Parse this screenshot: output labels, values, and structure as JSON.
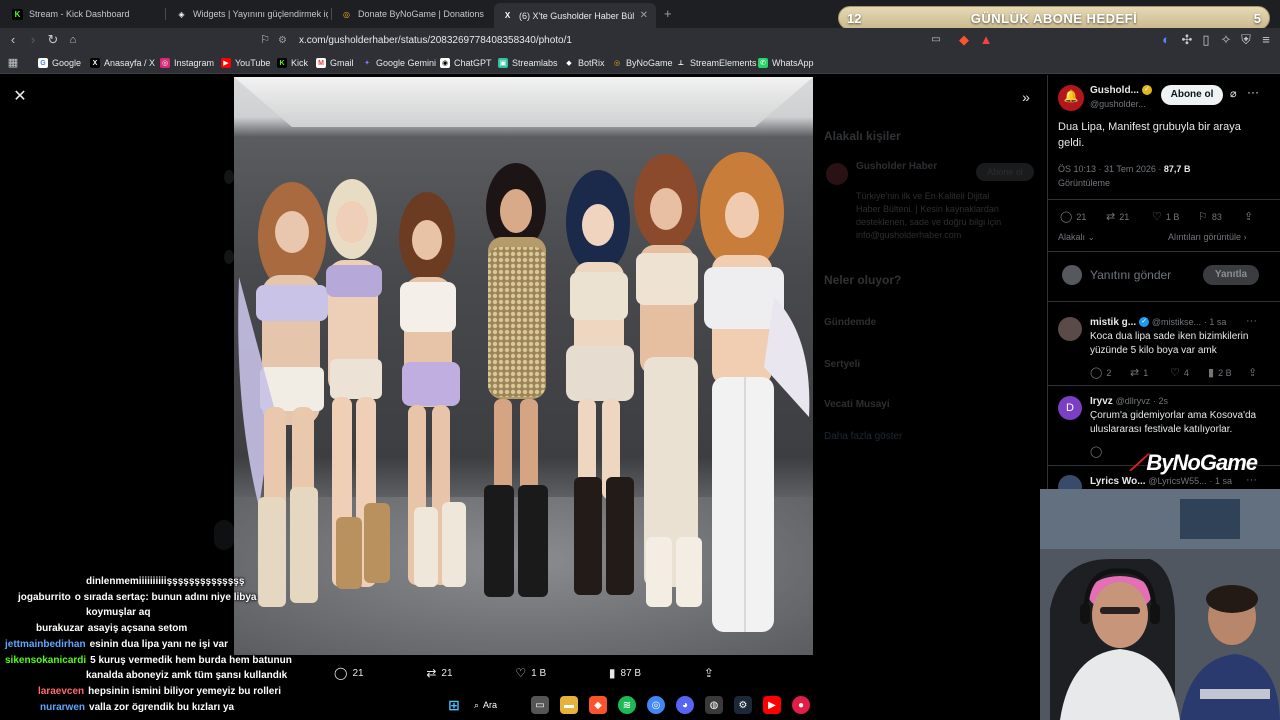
{
  "tabs": [
    {
      "title": "Stream - Kick Dashboard",
      "icon": "kick-icon",
      "color": "#53fc18"
    },
    {
      "title": "Widgets | Yayınını güçlendirmek için",
      "icon": "streamelements-icon",
      "color": "#ffffff"
    },
    {
      "title": "Donate ByNoGame | Donations",
      "icon": "bynogame-icon",
      "color": "#f5a623"
    },
    {
      "title": "(6) X'te Gusholder Haber Bülteni",
      "icon": "x-icon",
      "color": "#ffffff"
    }
  ],
  "new_tab": "+",
  "goal": {
    "left": "12",
    "title": "GÜNLÜK ABONE HEDEFİ",
    "right": "5"
  },
  "address": {
    "url": "x.com/gusholderhaber/status/2083269778408358340/photo/1"
  },
  "bookmarks": [
    {
      "label": "Google",
      "color": "#4285f4",
      "glyph": "G"
    },
    {
      "label": "Anasayfa / X",
      "color": "#000000",
      "glyph": "X"
    },
    {
      "label": "Instagram",
      "color": "#d62976",
      "glyph": "◎"
    },
    {
      "label": "YouTube",
      "color": "#ff0000",
      "glyph": "▶"
    },
    {
      "label": "Kick",
      "color": "#53fc18",
      "glyph": "K"
    },
    {
      "label": "Gmail",
      "color": "#ea4335",
      "glyph": "M"
    },
    {
      "label": "Google Gemini",
      "color": "#8e75ff",
      "glyph": "✦"
    },
    {
      "label": "ChatGPT",
      "color": "#10a37f",
      "glyph": "◉"
    },
    {
      "label": "Streamlabs",
      "color": "#31c3a2",
      "glyph": "▣"
    },
    {
      "label": "BotRix",
      "color": "#9146ff",
      "glyph": "◆"
    },
    {
      "label": "ByNoGame",
      "color": "#f5a623",
      "glyph": "B"
    },
    {
      "label": "StreamElements",
      "color": "#2b2d42",
      "glyph": "S"
    },
    {
      "label": "WhatsApp",
      "color": "#25d366",
      "glyph": "✆"
    }
  ],
  "photo_actions": {
    "replies": "21",
    "reposts": "21",
    "likes": "1 B",
    "views": "87 B"
  },
  "tweet": {
    "author_name": "Gushold...",
    "author_handle": "@gusholder...",
    "follow_label": "Abone ol",
    "text_line1": "Dua Lipa, Manifest grubuyla bir araya",
    "text_line2": "geldi.",
    "meta": "ÖS 10:13 · 31 Tem 2026 ·",
    "views_count": "87,7 B",
    "views_label": "Görüntüleme",
    "replies": "21",
    "reposts": "21",
    "likes": "1 B",
    "bookmarks": "83",
    "sort_label": "Alakalı",
    "quotes_label": "Alıntıları görüntüle",
    "reply_placeholder": "Yanıtını gönder",
    "reply_button": "Yanıtla"
  },
  "replies": [
    {
      "name": "mistik g...",
      "handle": "@mistikse...",
      "time": "· 1 sa",
      "line1": "Koca dua lipa sade iken bizimkilerin",
      "line2": "yüzünde 5 kilo boya var amk",
      "r": "2",
      "rt": "1",
      "lk": "4",
      "vw": "2 B"
    },
    {
      "name": "Iryvz",
      "handle": "@dllryvz",
      "time": "· 2s",
      "line1": "Çorum'a gidemiyorlar ama Kosova'da",
      "line2": "uluslararası festivale katılıyorlar.",
      "r": "",
      "rt": "",
      "lk": "",
      "vw": ""
    },
    {
      "name": "Lyrics Wo...",
      "handle": "@LyricsW55...",
      "time": "· 1 sa"
    }
  ],
  "background_panel": {
    "who_title": "Alakalı kişiler",
    "who_name": "Gusholder Haber",
    "follow": "Abone ol",
    "bio1": "Türkiye'nin ilk ve En Kaliteli Dijital",
    "bio2": "Haber Bülteni. | Kesin kaynaklardan",
    "bio3": "desteklenen, sade ve doğru bilgi için",
    "bio4": "info@gusholderhaber.com",
    "trends_title": "Neler oluyor?",
    "t1": "Gündemde",
    "t2": "Sertyeli",
    "t3": "Vecati Musayi",
    "more": "Daha fazla göster"
  },
  "chat": [
    {
      "user": "",
      "color": "#ffffff",
      "msg": "dinlenmemiiiiiiiiiişşşşşşşşşşşşşş"
    },
    {
      "user": "jogaburrito",
      "color": "#ffffff",
      "msg": "o sırada sertaç: bunun adını niye libya"
    },
    {
      "user": "",
      "color": "#ffffff",
      "msg": "koymuşlar aq"
    },
    {
      "user": "burakuzar",
      "color": "#ffffff",
      "msg": "asayiş açsana setom"
    },
    {
      "user": "jettmainbedirhan",
      "color": "#60a5ff",
      "msg": "esinin dua lipa yanı ne işi var"
    },
    {
      "user": "sikensokanicardi",
      "color": "#53fc18",
      "msg": "5 kuruş vermedik hem burda hem batunun"
    },
    {
      "user": "",
      "color": "#ffffff",
      "msg": "kanalda aboneyiz amk tüm şansı kullandık"
    },
    {
      "user": "laraevcen",
      "color": "#ff6b6b",
      "msg": "hepsinin ismini biliyor yemeyiz bu rolleri"
    },
    {
      "user": "nurarwen",
      "color": "#60a5ff",
      "msg": "valla zor ögrendik bu kızları ya"
    }
  ],
  "logo": {
    "text": "ByNoGame"
  },
  "taskbar": {
    "search_label": "Ara"
  }
}
